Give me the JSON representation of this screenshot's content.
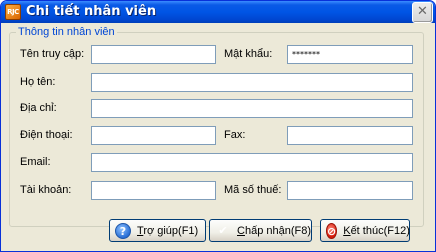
{
  "window": {
    "title": "Chi tiết nhân viên",
    "app_icon_text": "RJC"
  },
  "group": {
    "caption": "Thông tin nhân viên"
  },
  "fields": {
    "username": {
      "label": "Tên truy cập:",
      "value": ""
    },
    "password": {
      "label": "Mật khẩu:",
      "value": "*******"
    },
    "fullname": {
      "label": "Họ tên:",
      "value": ""
    },
    "address": {
      "label": "Địa chỉ:",
      "value": ""
    },
    "phone": {
      "label": "Điện thoại:",
      "value": ""
    },
    "fax": {
      "label": "Fax:",
      "value": ""
    },
    "email": {
      "label": "Email:",
      "value": ""
    },
    "account": {
      "label": "Tài khoản:",
      "value": ""
    },
    "tax_code": {
      "label": "Mã số thuế:",
      "value": ""
    }
  },
  "buttons": {
    "help": {
      "label": "Trợ giúp(F1)",
      "icon": "help-icon"
    },
    "accept": {
      "label": "Chấp nhận(F8)",
      "icon": "checkmark-icon"
    },
    "close": {
      "label": "Kết thúc(F12)",
      "icon": "stop-icon"
    }
  },
  "colors": {
    "titlebar": "#0055e5",
    "group_caption": "#0046d5",
    "field_border": "#7f9db9",
    "dialog_bg": "#ece9d8"
  }
}
